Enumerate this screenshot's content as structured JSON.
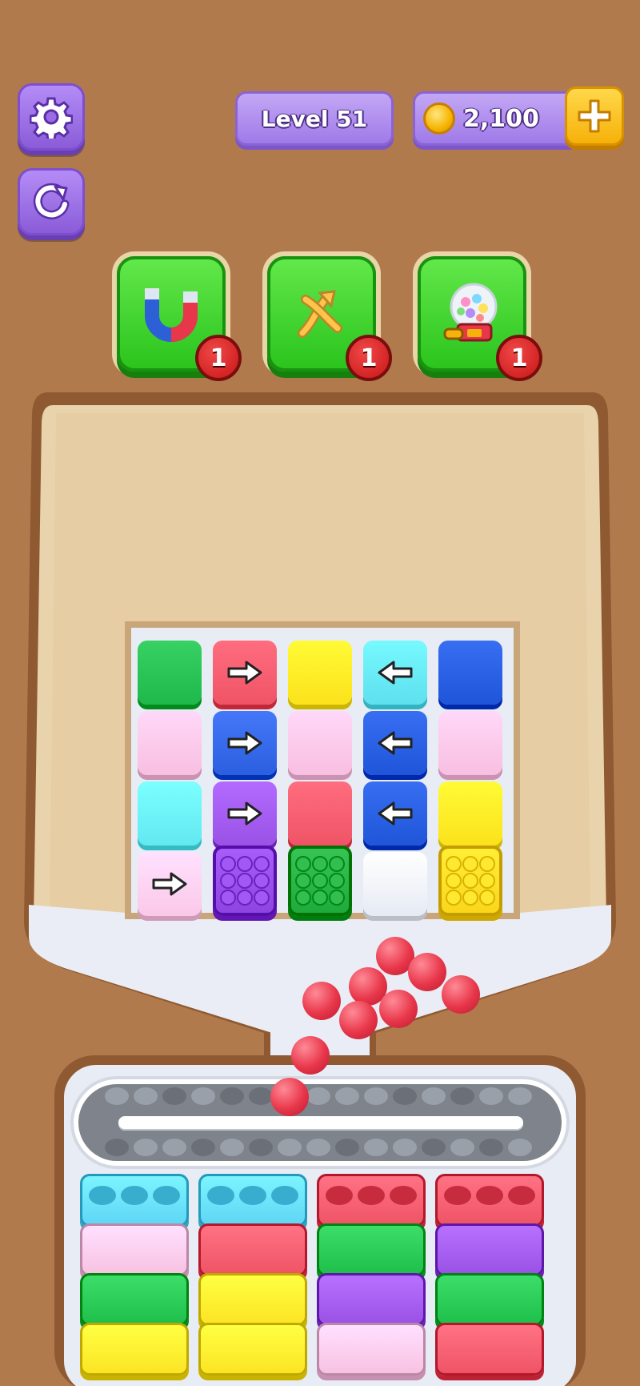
{
  "top_bar": {
    "level_label": "Level 51",
    "coins": "2,100",
    "settings_icon": "gear-icon",
    "restart_icon": "restart-icon",
    "add_icon": "plus-icon"
  },
  "boosters": [
    {
      "name": "magnet",
      "icon": "magnet-icon",
      "count": "1"
    },
    {
      "name": "shuffle",
      "icon": "shuffle-icon",
      "count": "1"
    },
    {
      "name": "gumball",
      "icon": "gumball-machine-icon",
      "count": "1"
    }
  ],
  "board": {
    "rows": [
      [
        {
          "color": "#1fb84a",
          "arrow": ""
        },
        {
          "color": "#ef5466",
          "arrow": "right"
        },
        {
          "color": "#fbe21c",
          "arrow": ""
        },
        {
          "color": "#5ee0ee",
          "arrow": "left"
        },
        {
          "color": "#1f55d8",
          "arrow": ""
        }
      ],
      [
        {
          "color": "#f8bfe0",
          "arrow": ""
        },
        {
          "color": "#2b5fe0",
          "arrow": "right"
        },
        {
          "color": "#f8bfe0",
          "arrow": ""
        },
        {
          "color": "#1f55d8",
          "arrow": "left"
        },
        {
          "color": "#f8bfe0",
          "arrow": ""
        }
      ],
      [
        {
          "color": "#62e8f0",
          "arrow": ""
        },
        {
          "color": "#9a52e6",
          "arrow": "right"
        },
        {
          "color": "#ef5466",
          "arrow": ""
        },
        {
          "color": "#1f55d8",
          "arrow": "left"
        },
        {
          "color": "#fbe21c",
          "arrow": ""
        }
      ],
      [
        {
          "color": "#fbc8e8",
          "arrow": "right"
        },
        {
          "color": "#8e44e0",
          "arrow": "",
          "studs": true
        },
        {
          "color": "#1faa3c",
          "arrow": "",
          "studs": true
        },
        {
          "color": "#e6ebf4",
          "arrow": ""
        },
        {
          "color": "#fbd51c",
          "arrow": "",
          "studs": true
        }
      ]
    ]
  },
  "stacks": [
    [
      "#5fd6f5",
      "#f8c2e2",
      "#1fbf4c",
      "#fbe524"
    ],
    [
      "#5fd6f5",
      "#ef5466",
      "#fbe524",
      "#fbe524"
    ],
    [
      "#ef5466",
      "#1fbf4c",
      "#9a52e6",
      "#f8c2e2"
    ],
    [
      "#ef5466",
      "#9a52e6",
      "#1fbf4c",
      "#ef5466"
    ]
  ],
  "colors": {
    "background": "#b07a4d",
    "tray": "#e6d0ac",
    "accent_purple": "#9f7ae8",
    "booster_green": "#2bc41d",
    "ball_red": "#e8364a"
  }
}
